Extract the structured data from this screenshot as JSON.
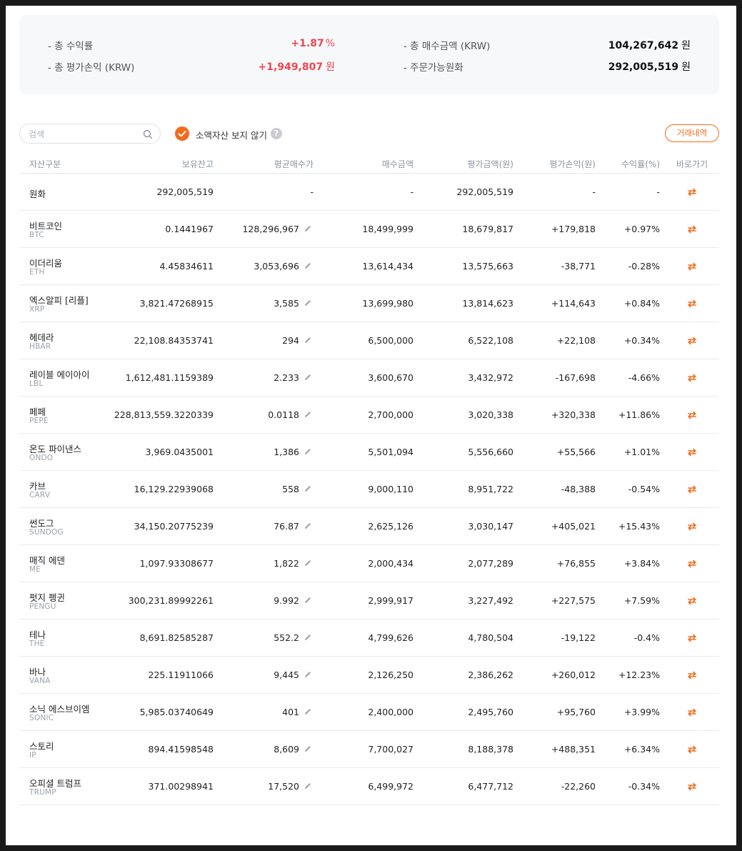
{
  "summary": {
    "total_return_label": "- 총 수익률",
    "total_return_value": "+1.87",
    "total_return_unit": "%",
    "total_pl_label": "- 총 평가손익 (KRW)",
    "total_pl_value": "+1,949,807",
    "total_pl_unit": "원",
    "total_buy_label": "- 총 매수금액 (KRW)",
    "total_buy_value": "104,267,642",
    "total_buy_unit": "원",
    "orderable_label": "- 주문가능원화",
    "orderable_value": "292,005,519",
    "orderable_unit": "원"
  },
  "controls": {
    "search_placeholder": "검색",
    "hide_small_label": "소액자산 보지 않기",
    "help_glyph": "?",
    "history_button": "거래내역"
  },
  "table": {
    "headers": [
      "자산구분",
      "보유잔고",
      "평균매수가",
      "매수금액",
      "평가금액(원)",
      "평가손익(원)",
      "수익률(%)",
      "바로가기"
    ],
    "krw_row": {
      "name": "원화",
      "balance": "292,005,519",
      "avg": "-",
      "buy": "-",
      "eval": "292,005,519",
      "pl": "-",
      "rate": "-"
    },
    "rows": [
      {
        "name": "비트코인",
        "ticker": "BTC",
        "balance": "0.1441967",
        "avg": "128,296,967",
        "buy": "18,499,999",
        "eval": "18,679,817",
        "pl": "+179,818",
        "rate": "+0.97%",
        "sign": "up"
      },
      {
        "name": "이더리움",
        "ticker": "ETH",
        "balance": "4.45834611",
        "avg": "3,053,696",
        "buy": "13,614,434",
        "eval": "13,575,663",
        "pl": "-38,771",
        "rate": "-0.28%",
        "sign": "down"
      },
      {
        "name": "엑스알피 [리플]",
        "ticker": "XRP",
        "balance": "3,821.47268915",
        "avg": "3,585",
        "buy": "13,699,980",
        "eval": "13,814,623",
        "pl": "+114,643",
        "rate": "+0.84%",
        "sign": "up"
      },
      {
        "name": "헤데라",
        "ticker": "HBAR",
        "balance": "22,108.84353741",
        "avg": "294",
        "buy": "6,500,000",
        "eval": "6,522,108",
        "pl": "+22,108",
        "rate": "+0.34%",
        "sign": "up"
      },
      {
        "name": "레이블 에이아이",
        "ticker": "LBL",
        "balance": "1,612,481.1159389",
        "avg": "2.233",
        "buy": "3,600,670",
        "eval": "3,432,972",
        "pl": "-167,698",
        "rate": "-4.66%",
        "sign": "down"
      },
      {
        "name": "페페",
        "ticker": "PEPE",
        "balance": "228,813,559.3220339",
        "avg": "0.0118",
        "buy": "2,700,000",
        "eval": "3,020,338",
        "pl": "+320,338",
        "rate": "+11.86%",
        "sign": "up"
      },
      {
        "name": "온도 파이낸스",
        "ticker": "ONDO",
        "balance": "3,969.0435001",
        "avg": "1,386",
        "buy": "5,501,094",
        "eval": "5,556,660",
        "pl": "+55,566",
        "rate": "+1.01%",
        "sign": "up"
      },
      {
        "name": "카브",
        "ticker": "CARV",
        "balance": "16,129.22939068",
        "avg": "558",
        "buy": "9,000,110",
        "eval": "8,951,722",
        "pl": "-48,388",
        "rate": "-0.54%",
        "sign": "down"
      },
      {
        "name": "썬도그",
        "ticker": "SUNDOG",
        "balance": "34,150.20775239",
        "avg": "76.87",
        "buy": "2,625,126",
        "eval": "3,030,147",
        "pl": "+405,021",
        "rate": "+15.43%",
        "sign": "up"
      },
      {
        "name": "매직 에덴",
        "ticker": "ME",
        "balance": "1,097.93308677",
        "avg": "1,822",
        "buy": "2,000,434",
        "eval": "2,077,289",
        "pl": "+76,855",
        "rate": "+3.84%",
        "sign": "up"
      },
      {
        "name": "펏지 펭귄",
        "ticker": "PENGU",
        "balance": "300,231.89992261",
        "avg": "9.992",
        "buy": "2,999,917",
        "eval": "3,227,492",
        "pl": "+227,575",
        "rate": "+7.59%",
        "sign": "up"
      },
      {
        "name": "테나",
        "ticker": "THE",
        "balance": "8,691.82585287",
        "avg": "552.2",
        "buy": "4,799,626",
        "eval": "4,780,504",
        "pl": "-19,122",
        "rate": "-0.4%",
        "sign": "down"
      },
      {
        "name": "바나",
        "ticker": "VANA",
        "balance": "225.11911066",
        "avg": "9,445",
        "buy": "2,126,250",
        "eval": "2,386,262",
        "pl": "+260,012",
        "rate": "+12.23%",
        "sign": "up"
      },
      {
        "name": "소닉 에스브이엠",
        "ticker": "SONIC",
        "balance": "5,985.03740649",
        "avg": "401",
        "buy": "2,400,000",
        "eval": "2,495,760",
        "pl": "+95,760",
        "rate": "+3.99%",
        "sign": "up"
      },
      {
        "name": "스토리",
        "ticker": "IP",
        "balance": "894.41598548",
        "avg": "8,609",
        "buy": "7,700,027",
        "eval": "8,188,378",
        "pl": "+488,351",
        "rate": "+6.34%",
        "sign": "up"
      },
      {
        "name": "오피셜 트럼프",
        "ticker": "TRUMP",
        "balance": "371.00298941",
        "avg": "17,520",
        "buy": "6,499,972",
        "eval": "6,477,712",
        "pl": "-22,260",
        "rate": "-0.34%",
        "sign": "down"
      }
    ]
  },
  "icons": {
    "search": "search-icon",
    "check": "check-icon",
    "edit": "pencil-icon",
    "shortcut": "swap-arrows-icon"
  },
  "colors": {
    "accent": "#f26b1d",
    "up": "#f04452",
    "down": "#3c6ed7"
  }
}
